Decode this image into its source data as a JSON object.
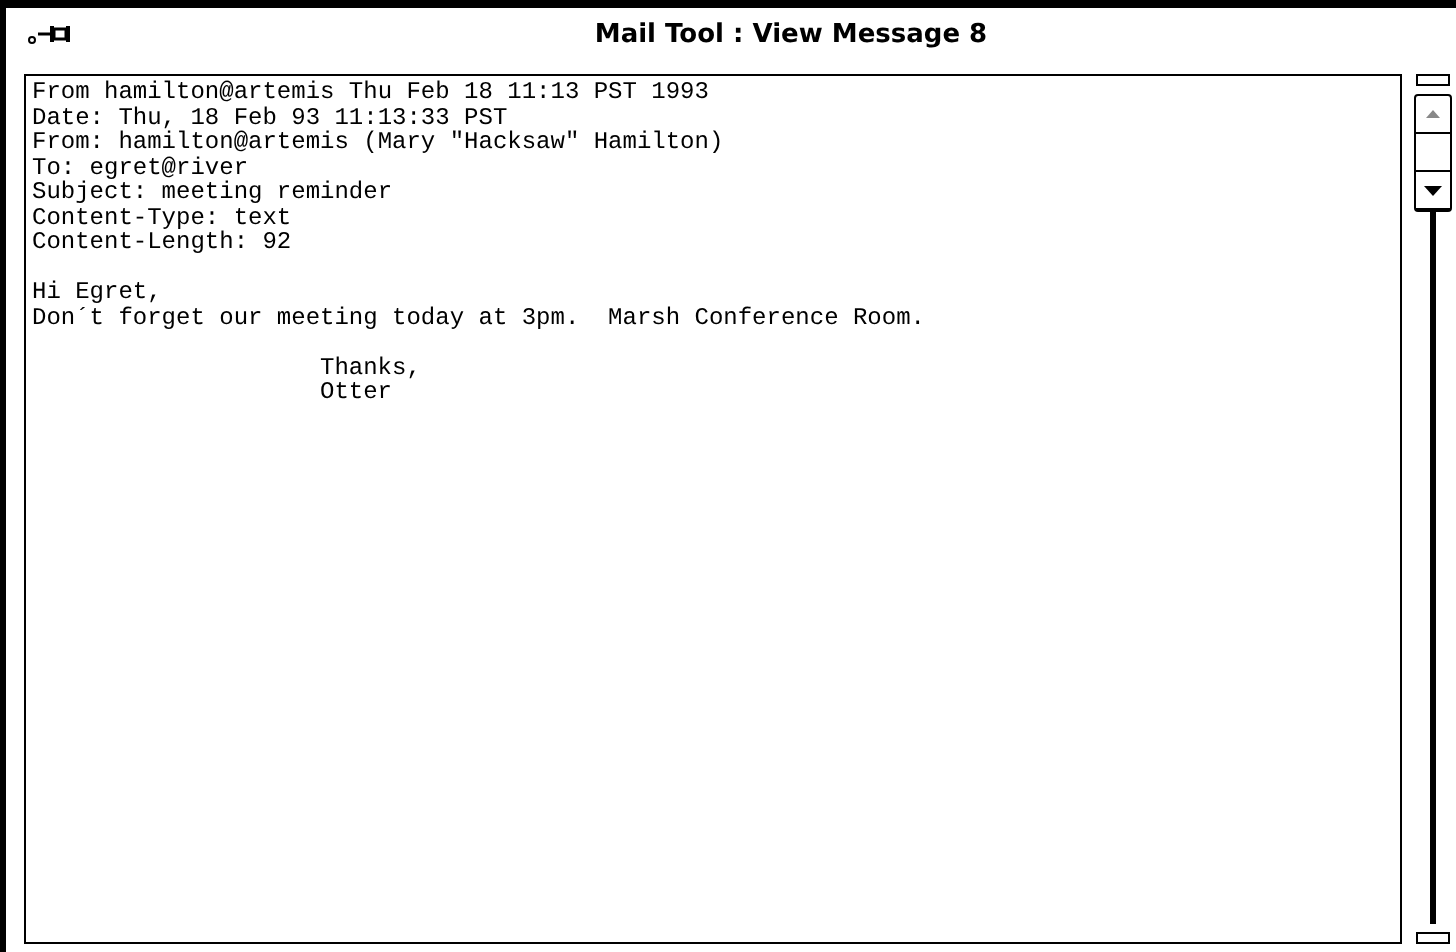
{
  "window": {
    "title": "Mail Tool : View Message 8"
  },
  "message": {
    "header_lines": [
      "From hamilton@artemis Thu Feb 18 11:13 PST 1993",
      "Date: Thu, 18 Feb 93 11:13:33 PST",
      "From: hamilton@artemis (Mary \"Hacksaw\" Hamilton)",
      "To: egret@river",
      "Subject: meeting reminder",
      "Content-Type: text",
      "Content-Length: 92"
    ],
    "body_lines": [
      "Hi Egret,",
      "Don´t forget our meeting today at 3pm.  Marsh Conference Room."
    ],
    "signature_lines": [
      "Thanks,",
      "Otter"
    ]
  }
}
